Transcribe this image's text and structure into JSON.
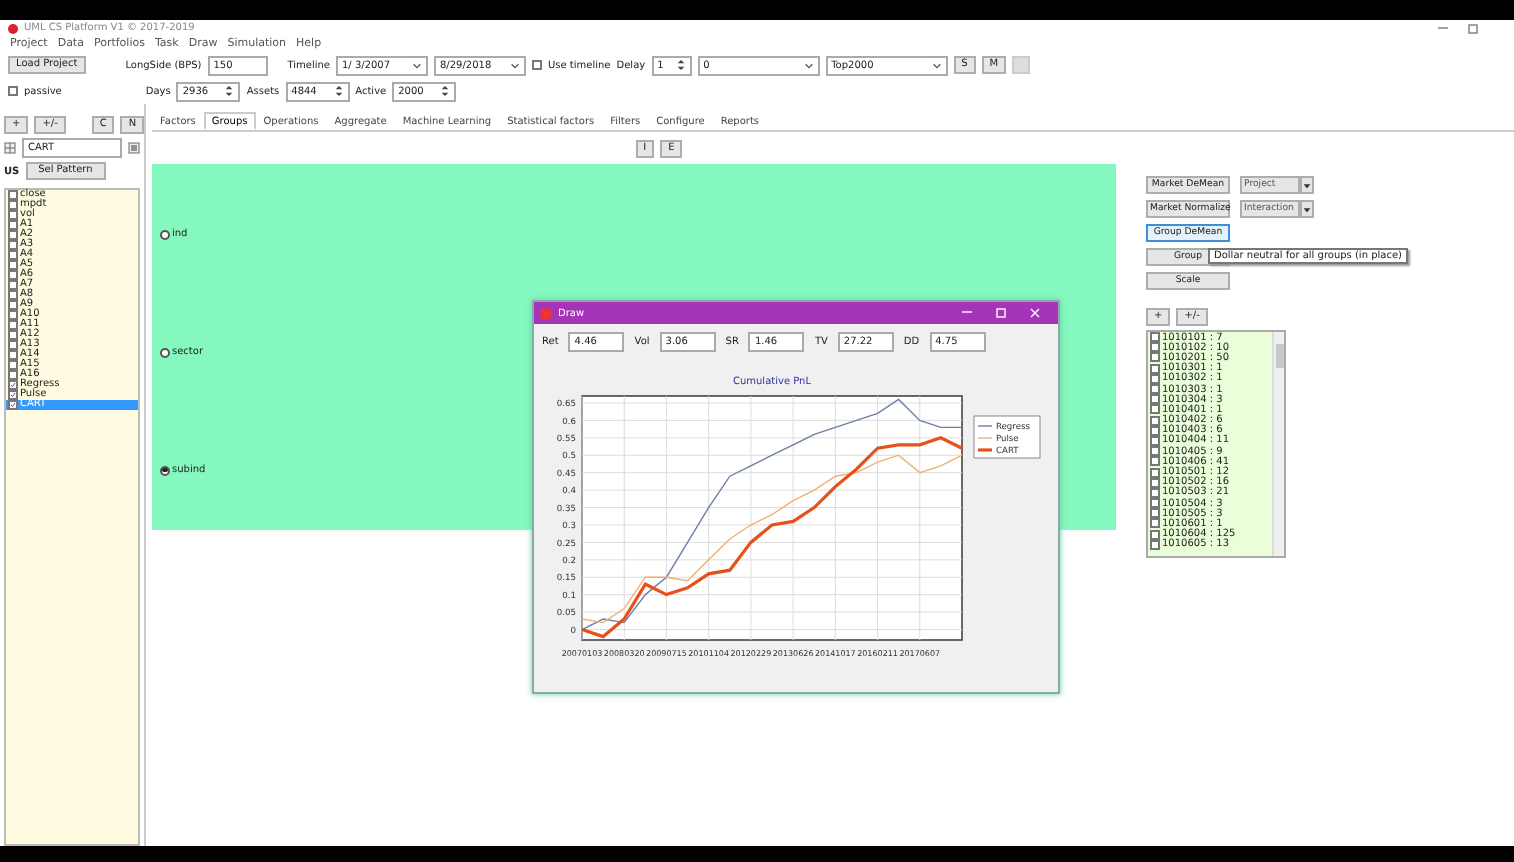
{
  "window": {
    "title": "UML CS Platform V1 © 2017-2019"
  },
  "menu": [
    "Project",
    "Data",
    "Portfolios",
    "Task",
    "Draw",
    "Simulation",
    "Help"
  ],
  "toolbar": {
    "load_button": "Load Project",
    "passive": {
      "label": "passive",
      "checked": false
    },
    "longside": {
      "label": "LongSide (BPS)",
      "value": "150"
    },
    "timeline": {
      "label": "Timeline",
      "start": "1/ 3/2007",
      "end": "8/29/2018"
    },
    "use_timeline": {
      "label": "Use timeline",
      "checked": false
    },
    "delay": {
      "label": "Delay",
      "value": "1"
    },
    "mode": {
      "value": "0"
    },
    "universe": {
      "value": "Top2000"
    },
    "buttons": [
      "S",
      "M"
    ],
    "days": {
      "label": "Days",
      "value": "2936"
    },
    "assets": {
      "label": "Assets",
      "value": "4844"
    },
    "active": {
      "label": "Active",
      "value": "2000"
    }
  },
  "left_panel": {
    "buttons": [
      "+",
      "+/-",
      "C",
      "N"
    ],
    "filter": {
      "value": "CART"
    },
    "region_label": "US",
    "pattern_button": "Sel Pattern",
    "factors": [
      {
        "label": "close",
        "checked": false,
        "selected": false
      },
      {
        "label": "mpdt",
        "checked": false,
        "selected": false
      },
      {
        "label": "vol",
        "checked": false,
        "selected": false
      },
      {
        "label": "A1",
        "checked": false,
        "selected": false
      },
      {
        "label": "A2",
        "checked": false,
        "selected": false
      },
      {
        "label": "A3",
        "checked": false,
        "selected": false
      },
      {
        "label": "A4",
        "checked": false,
        "selected": false
      },
      {
        "label": "A5",
        "checked": false,
        "selected": false
      },
      {
        "label": "A6",
        "checked": false,
        "selected": false
      },
      {
        "label": "A7",
        "checked": false,
        "selected": false
      },
      {
        "label": "A8",
        "checked": false,
        "selected": false
      },
      {
        "label": "A9",
        "checked": false,
        "selected": false
      },
      {
        "label": "A10",
        "checked": false,
        "selected": false
      },
      {
        "label": "A11",
        "checked": false,
        "selected": false
      },
      {
        "label": "A12",
        "checked": false,
        "selected": false
      },
      {
        "label": "A13",
        "checked": false,
        "selected": false
      },
      {
        "label": "A14",
        "checked": false,
        "selected": false
      },
      {
        "label": "A15",
        "checked": false,
        "selected": false
      },
      {
        "label": "A16",
        "checked": false,
        "selected": false
      },
      {
        "label": "Regress",
        "checked": true,
        "selected": false
      },
      {
        "label": "Pulse",
        "checked": true,
        "selected": false
      },
      {
        "label": "CART",
        "checked": true,
        "selected": true
      }
    ]
  },
  "tabs": [
    {
      "label": "Factors",
      "selected": false
    },
    {
      "label": "Groups",
      "selected": true
    },
    {
      "label": "Operations",
      "selected": false
    },
    {
      "label": "Aggregate",
      "selected": false
    },
    {
      "label": "Machine Learning",
      "selected": false
    },
    {
      "label": "Statistical factors",
      "selected": false
    },
    {
      "label": "Filters",
      "selected": false
    },
    {
      "label": "Configure",
      "selected": false
    },
    {
      "label": "Reports",
      "selected": false
    }
  ],
  "group_buttons": [
    "I",
    "E"
  ],
  "group_options": [
    {
      "label": "ind",
      "selected": false
    },
    {
      "label": "sector",
      "selected": false
    },
    {
      "label": "subind",
      "selected": true
    }
  ],
  "right_panel": {
    "button_rows": [
      [
        {
          "label": "Market DeMean",
          "kind": "plain",
          "focused": false
        },
        {
          "label": "Project",
          "kind": "menu",
          "focused": false
        }
      ],
      [
        {
          "label": "Market Normalize",
          "kind": "plain",
          "focused": false
        },
        {
          "label": "Interaction",
          "kind": "menu",
          "focused": false
        }
      ],
      [
        {
          "label": "Group DeMean",
          "kind": "plain",
          "focused": true
        }
      ],
      [
        {
          "label": "Group",
          "kind": "plain",
          "focused": false
        }
      ],
      [
        {
          "label": "Scale",
          "kind": "plain",
          "focused": false
        }
      ]
    ],
    "tooltip": "Dollar neutral for all groups (in place)",
    "small_buttons": [
      "+",
      "+/-"
    ],
    "groups": [
      {
        "label": "1010101 : 7",
        "checked": false
      },
      {
        "label": "1010102 : 10",
        "checked": false
      },
      {
        "label": "1010201 : 50",
        "checked": false
      },
      {
        "label": "1010301 : 1",
        "checked": false
      },
      {
        "label": "1010302 : 1",
        "checked": false
      },
      {
        "label": "1010303 : 1",
        "checked": false
      },
      {
        "label": "1010304 : 3",
        "checked": false
      },
      {
        "label": "1010401 : 1",
        "checked": false
      },
      {
        "label": "1010402 : 6",
        "checked": false
      },
      {
        "label": "1010403 : 6",
        "checked": false
      },
      {
        "label": "1010404 : 11",
        "checked": false
      },
      {
        "label": "1010405 : 9",
        "checked": false
      },
      {
        "label": "1010406 : 41",
        "checked": false
      },
      {
        "label": "1010501 : 12",
        "checked": false
      },
      {
        "label": "1010502 : 16",
        "checked": false
      },
      {
        "label": "1010503 : 21",
        "checked": false
      },
      {
        "label": "1010504 : 3",
        "checked": false
      },
      {
        "label": "1010505 : 3",
        "checked": false
      },
      {
        "label": "1010601 : 1",
        "checked": false
      },
      {
        "label": "1010604 : 125",
        "checked": false
      },
      {
        "label": "1010605 : 13",
        "checked": false
      }
    ]
  },
  "draw_window": {
    "title": "Draw",
    "metrics": [
      {
        "label": "Ret",
        "value": "4.46"
      },
      {
        "label": "Vol",
        "value": "3.06"
      },
      {
        "label": "SR",
        "value": "1.46"
      },
      {
        "label": "TV",
        "value": "27.22"
      },
      {
        "label": "DD",
        "value": "4.75"
      }
    ],
    "chart_data": {
      "type": "line",
      "title": "Cumulative PnL",
      "categories": [
        "20070103",
        null,
        "20080320",
        null,
        "20090715",
        null,
        "20101104",
        null,
        "20120229",
        null,
        "20130626",
        null,
        "20141017",
        null,
        "20160211",
        null,
        "20170607",
        null,
        null
      ],
      "ylim": [
        -0.03,
        0.67
      ],
      "grid": true,
      "legend": "right",
      "yticks": [
        0,
        0.05,
        0.1,
        0.15,
        0.2,
        0.25,
        0.3,
        0.35,
        0.4,
        0.45,
        0.5,
        0.55,
        0.6,
        0.65
      ],
      "series": [
        {
          "name": "Regress",
          "color": "#6a7fa8",
          "values": [
            0,
            0.03,
            0.02,
            0.1,
            0.15,
            0.25,
            0.35,
            0.44,
            0.47,
            0.5,
            0.53,
            0.56,
            0.58,
            0.6,
            0.62,
            0.66,
            0.6,
            0.58,
            0.58
          ]
        },
        {
          "name": "Pulse",
          "color": "#f0b070",
          "values": [
            0.03,
            0.02,
            0.06,
            0.15,
            0.15,
            0.14,
            0.2,
            0.26,
            0.3,
            0.33,
            0.37,
            0.4,
            0.44,
            0.45,
            0.48,
            0.5,
            0.45,
            0.47,
            0.5
          ]
        },
        {
          "name": "CART",
          "color": "#e8501a",
          "values": [
            0,
            -0.02,
            0.03,
            0.13,
            0.1,
            0.12,
            0.16,
            0.17,
            0.25,
            0.3,
            0.31,
            0.35,
            0.41,
            0.46,
            0.52,
            0.53,
            0.53,
            0.55,
            0.52
          ]
        }
      ]
    }
  }
}
